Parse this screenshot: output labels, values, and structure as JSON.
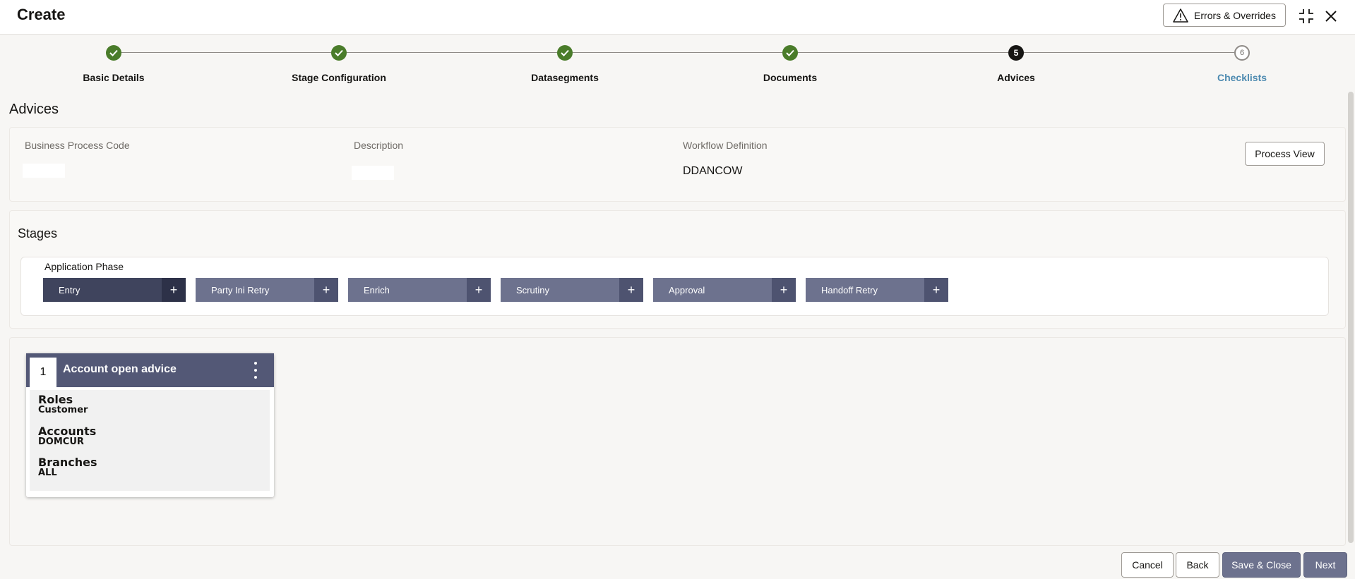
{
  "header": {
    "title": "Create",
    "errors_label": "Errors & Overrides"
  },
  "stepper": {
    "steps": [
      {
        "label": "Basic Details",
        "state": "done",
        "number": ""
      },
      {
        "label": "Stage Configuration",
        "state": "done",
        "number": ""
      },
      {
        "label": "Datasegments",
        "state": "done",
        "number": ""
      },
      {
        "label": "Documents",
        "state": "done",
        "number": ""
      },
      {
        "label": "Advices",
        "state": "current",
        "number": "5"
      },
      {
        "label": "Checklists",
        "state": "todo",
        "number": "6"
      }
    ]
  },
  "section": {
    "title": "Advices"
  },
  "details": {
    "business_process_code_label": "Business Process Code",
    "business_process_code_value": "",
    "description_label": "Description",
    "description_value": "",
    "workflow_definition_label": "Workflow Definition",
    "workflow_definition_value": "DDANCOW",
    "process_view_label": "Process View"
  },
  "stages": {
    "title": "Stages",
    "phase_label": "Application Phase",
    "items": [
      {
        "label": "Entry",
        "active": true
      },
      {
        "label": "Party Ini Retry",
        "active": false
      },
      {
        "label": "Enrich",
        "active": false
      },
      {
        "label": "Scrutiny",
        "active": false
      },
      {
        "label": "Approval",
        "active": false
      },
      {
        "label": "Handoff Retry",
        "active": false
      }
    ],
    "plus_symbol": "+"
  },
  "advice_card": {
    "number": "1",
    "title": "Account open advice",
    "roles_label": "Roles",
    "roles_value": "Customer",
    "accounts_label": "Accounts",
    "accounts_value": "DOMCUR",
    "branches_label": "Branches",
    "branches_value": "ALL"
  },
  "footer": {
    "cancel_label": "Cancel",
    "back_label": "Back",
    "save_close_label": "Save & Close",
    "next_label": "Next"
  },
  "colors": {
    "step_done": "#4a7c2a",
    "stage_chip": "#6d728e",
    "stage_chip_active": "#3f445d",
    "card_header": "#535876",
    "todo_text": "#4d8ab0"
  }
}
